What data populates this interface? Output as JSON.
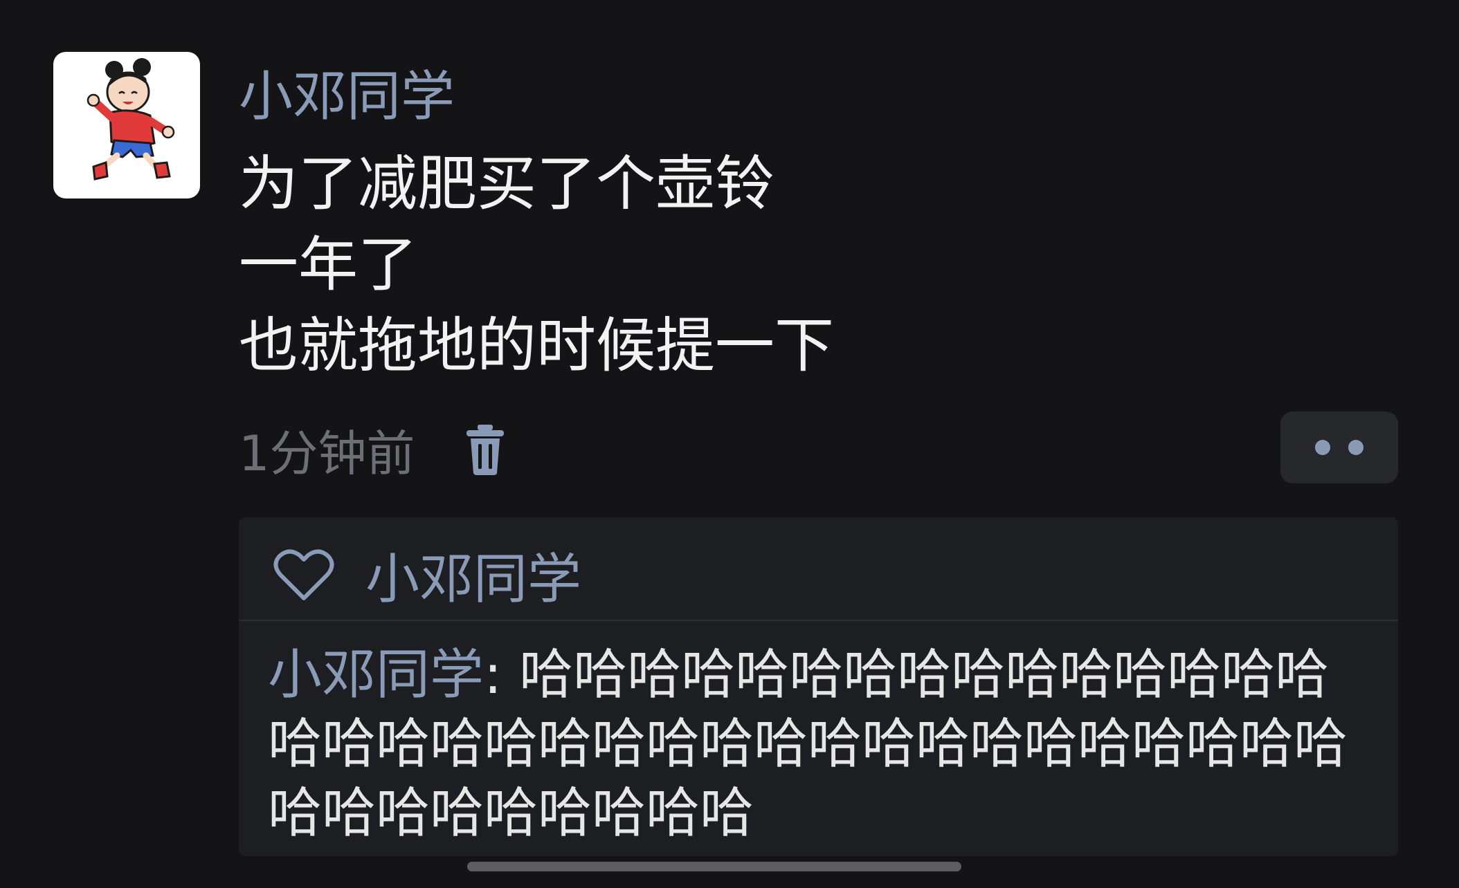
{
  "post": {
    "author": "小邓同学",
    "content_lines": [
      "为了减肥买了个壶铃",
      "一年了",
      "也就拖地的时候提一下"
    ],
    "timestamp": "1分钟前",
    "delete_icon": "trash-icon",
    "more_icon": "more-dots-icon"
  },
  "likes": {
    "icon": "heart-icon",
    "names": "小邓同学"
  },
  "comments": [
    {
      "author": "小邓同学",
      "separator": ": ",
      "text": "哈哈哈哈哈哈哈哈哈哈哈哈哈哈哈哈哈哈哈哈哈哈哈哈哈哈哈哈哈哈哈哈哈哈哈哈哈哈哈哈哈哈哈哈"
    }
  ],
  "colors": {
    "background": "#141416",
    "name_accent": "#8a9bb8",
    "text": "#f2f2f2",
    "muted": "#6d6f74",
    "panel": "#1d1e21"
  }
}
